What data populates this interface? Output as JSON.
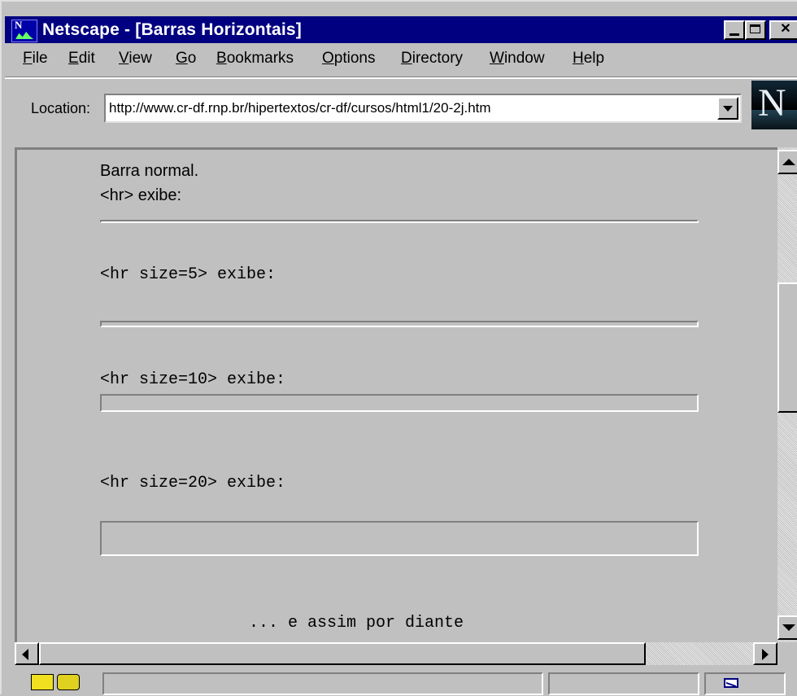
{
  "window": {
    "title": "Netscape - [Barras Horizontais]"
  },
  "menu": {
    "file": {
      "u": "F",
      "rest": "ile"
    },
    "edit": {
      "u": "E",
      "rest": "dit"
    },
    "view": {
      "u": "V",
      "rest": "iew"
    },
    "go": {
      "u": "G",
      "rest": "o"
    },
    "bookmarks": {
      "u": "B",
      "rest": "ookmarks"
    },
    "options": {
      "u": "O",
      "rest": "ptions"
    },
    "directory": {
      "u": "D",
      "rest": "irectory"
    },
    "window": {
      "u": "W",
      "rest": "indow"
    },
    "help": {
      "u": "H",
      "rest": "elp"
    }
  },
  "location": {
    "label": "Location:",
    "url": "http://www.cr-df.rnp.br/hipertextos/cr-df/cursos/html1/20-2j.htm"
  },
  "logo": {
    "letter": "N"
  },
  "content": {
    "line1": "Barra normal.",
    "line2": "<hr> exibe:",
    "hr5_label": "<hr size=5> exibe:",
    "hr10_label": "<hr size=10> exibe:",
    "hr20_label": "<hr size=20> exibe:",
    "footer": "... e assim por diante"
  },
  "icons": {
    "app": "netscape-app-icon",
    "minimize": "minimize-icon",
    "maximize": "maximize-icon",
    "close": "close-icon",
    "dropdown": "chevron-down-icon",
    "security": "security-key-icon",
    "mail": "mail-icon"
  }
}
